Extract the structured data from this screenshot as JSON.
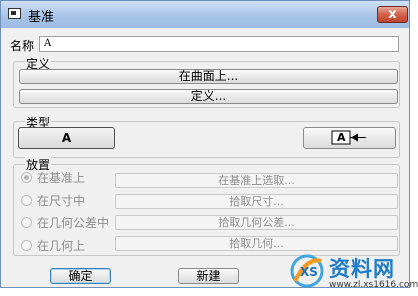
{
  "window": {
    "title": "基准",
    "close_label": "x"
  },
  "name_field": {
    "label": "名称",
    "value": "A"
  },
  "definition": {
    "title": "定义",
    "on_surface_button": "在曲面上...",
    "define_button": "定义..."
  },
  "type_group": {
    "title": "类型",
    "buttons": [
      {
        "label": "A",
        "selected": true
      },
      {
        "label": "A",
        "icon": "datum-arrow-icon",
        "selected": false
      }
    ]
  },
  "placement": {
    "title": "放置",
    "options": [
      {
        "label": "在基准上",
        "checked": true,
        "field": "在基准上选取..."
      },
      {
        "label": "在尺寸中",
        "checked": false,
        "field": "拾取尺寸..."
      },
      {
        "label": "在几何公差中",
        "checked": false,
        "field": "拾取几何公差..."
      },
      {
        "label": "在几何上",
        "checked": false,
        "field": "拾取几何..."
      }
    ]
  },
  "footer": {
    "ok_button": "确定",
    "new_button": "新建"
  },
  "watermark": {
    "brand": "资料网",
    "url": "www.zl.xs1616.com"
  }
}
